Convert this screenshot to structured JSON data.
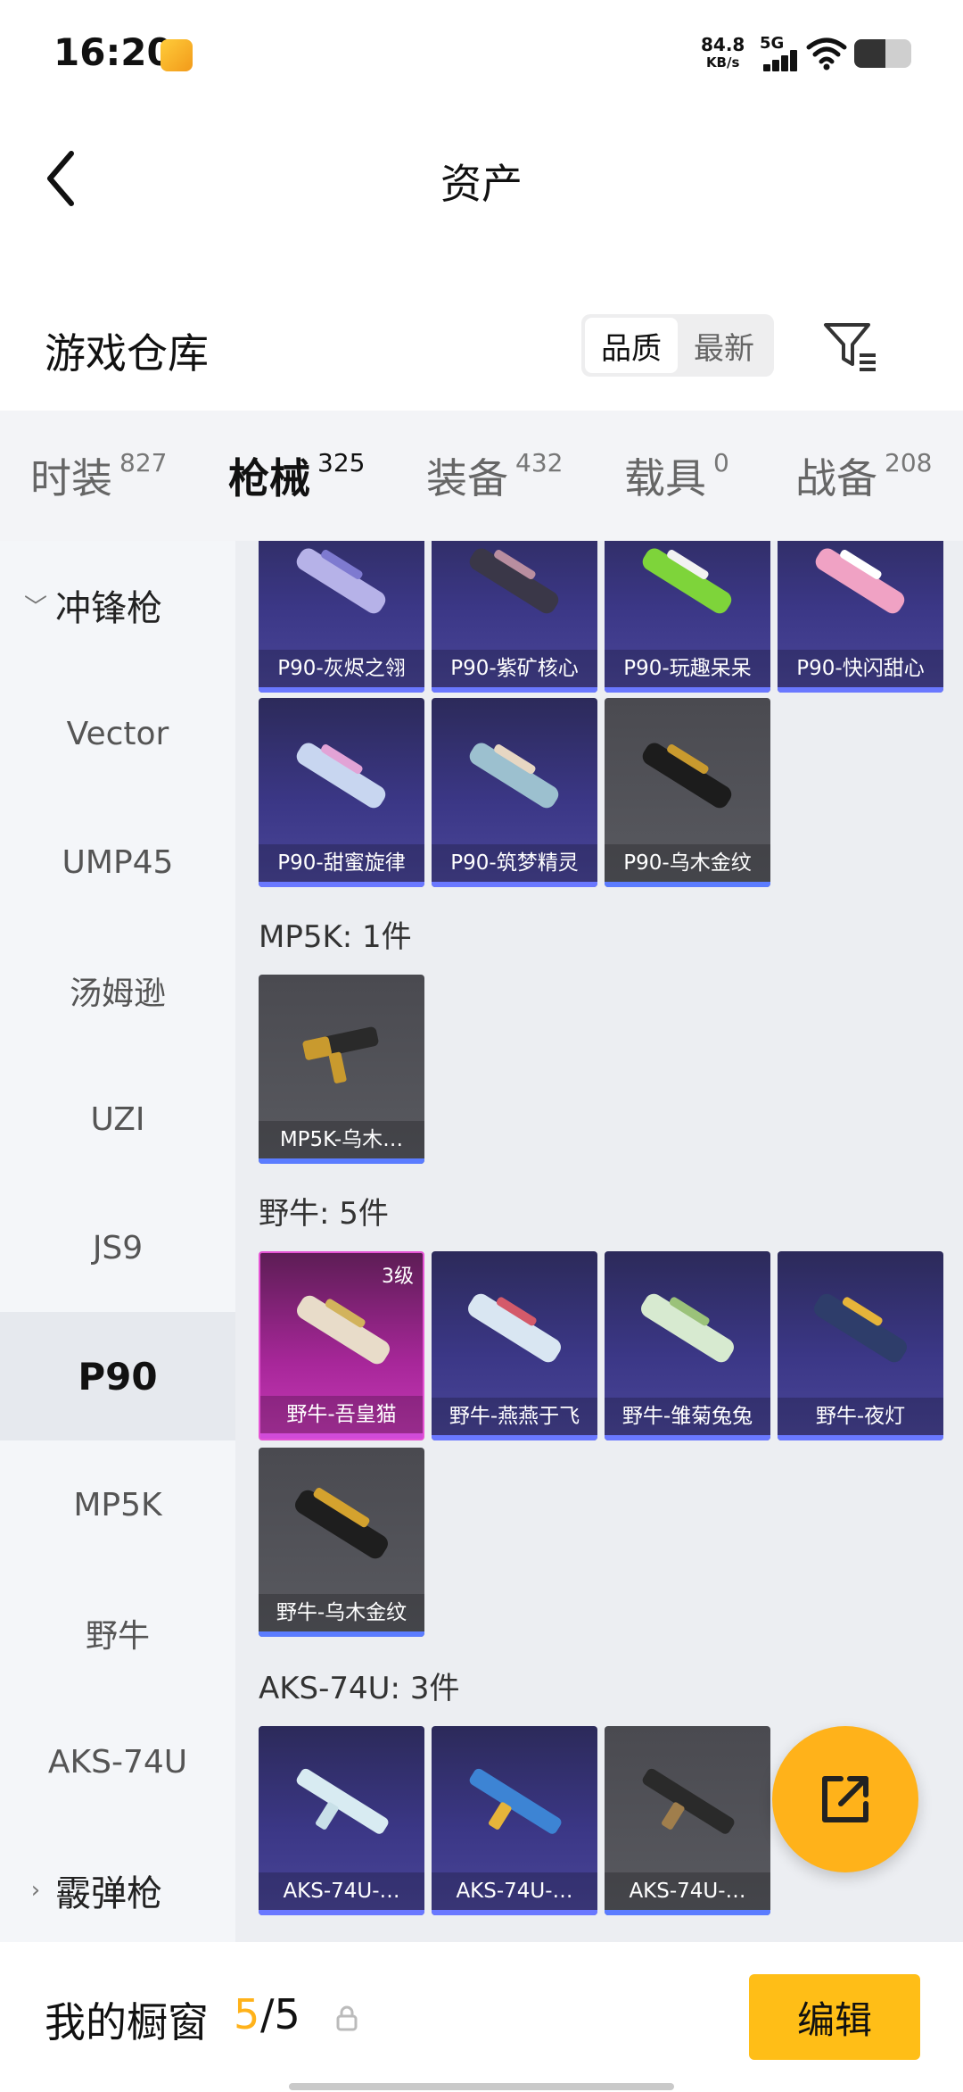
{
  "status_bar": {
    "time": "16:20",
    "net_speed_value": "84.8",
    "net_speed_unit": "KB/s",
    "network": "5G"
  },
  "header": {
    "title": "资产"
  },
  "warehouse": {
    "title": "游戏仓库",
    "sort_options": [
      "品质",
      "最新"
    ]
  },
  "tabs": [
    {
      "label": "时装",
      "count": "827"
    },
    {
      "label": "枪械",
      "count": "325"
    },
    {
      "label": "装备",
      "count": "432"
    },
    {
      "label": "载具",
      "count": "0"
    },
    {
      "label": "战备",
      "count": "208"
    }
  ],
  "sidebar": {
    "group_open": "冲锋枪",
    "items": [
      "Vector",
      "UMP45",
      "汤姆逊",
      "UZI",
      "JS9",
      "P90",
      "MP5K",
      "野牛",
      "AKS-74U"
    ],
    "group_closed": "霰弹枪"
  },
  "sections": {
    "p90_row1": [
      "P90-灰烬之翎",
      "P90-紫矿核心",
      "P90-玩趣呆呆",
      "P90-快闪甜心"
    ],
    "p90_row2": [
      "P90-甜蜜旋律",
      "P90-筑梦精灵",
      "P90-乌木金纹"
    ],
    "mp5k_title": "MP5K: 1件",
    "mp5k": [
      "MP5K-乌木…"
    ],
    "bison_title": "野牛: 5件",
    "bison_row1": [
      "野牛-吾皇猫",
      "野牛-燕燕于飞",
      "野牛-雏菊兔兔",
      "野牛-夜灯"
    ],
    "bison_level": "3级",
    "bison_row2": [
      "野牛-乌木金纹"
    ],
    "aks_title": "AKS-74U: 3件",
    "aks": [
      "AKS-74U-…",
      "AKS-74U-…",
      "AKS-74U-…"
    ]
  },
  "bottom_bar": {
    "label": "我的橱窗",
    "current": "5",
    "total": "/5",
    "edit_label": "编辑"
  },
  "colors": {
    "accent": "#ffb21a",
    "purple_card": "#3b3786",
    "gray_card": "#595a60",
    "pink_card": "#a8279a"
  },
  "icons": [
    "back-arrow-icon",
    "filter-icon",
    "share-icon",
    "lock-icon",
    "chevron-down-icon",
    "chevron-right-icon",
    "wifi-icon",
    "signal-icon",
    "battery-icon"
  ]
}
